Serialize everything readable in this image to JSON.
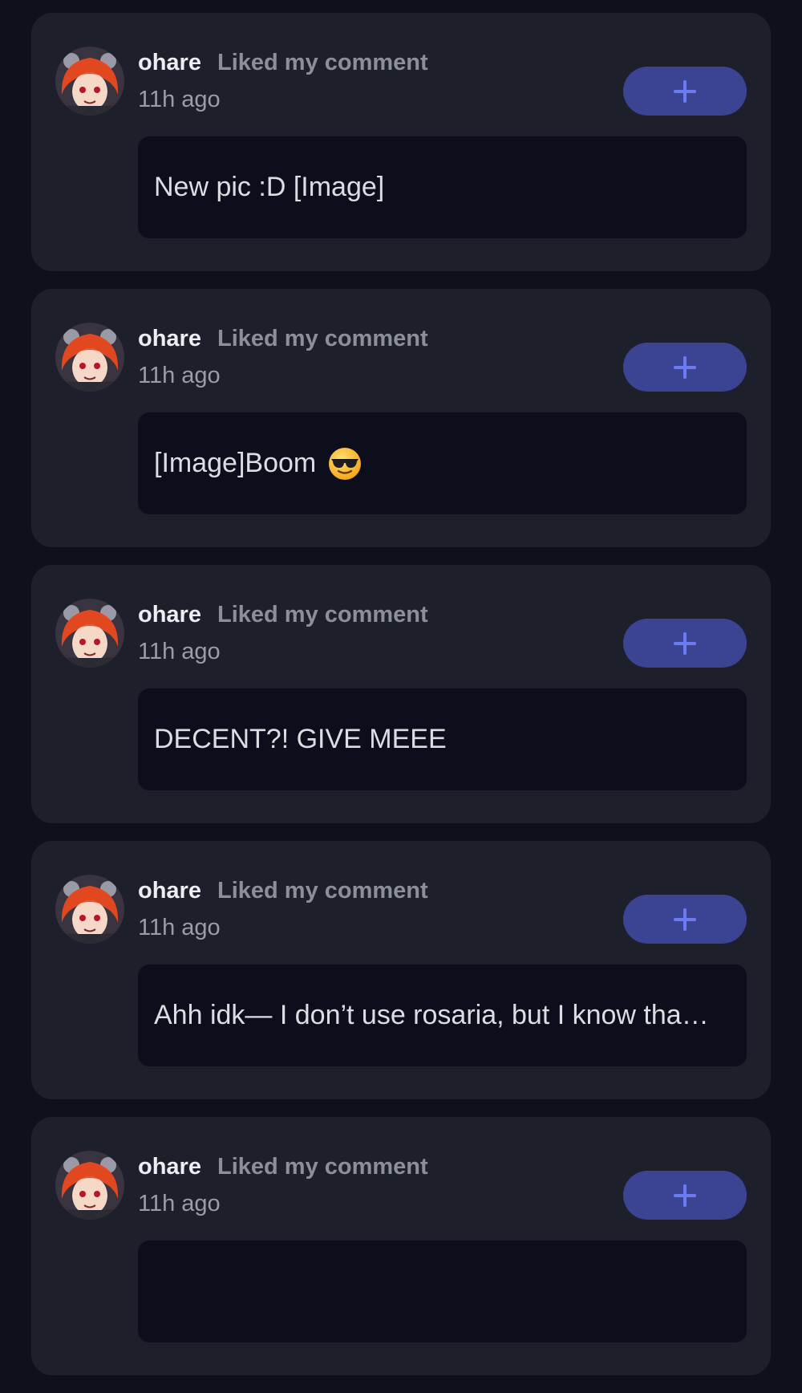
{
  "accent_color": "#3b4393",
  "plus_icon_color": "#6b7cf2",
  "notifications": [
    {
      "username": "ohare",
      "action": "Liked my comment",
      "time": "11h ago",
      "comment": "New pic :D [Image]",
      "emoji": null,
      "button_icon": "plus-icon"
    },
    {
      "username": "ohare",
      "action": "Liked my comment",
      "time": "11h ago",
      "comment": "[Image]Boom",
      "emoji": "sunglasses-emoji",
      "button_icon": "plus-icon"
    },
    {
      "username": "ohare",
      "action": "Liked my comment",
      "time": "11h ago",
      "comment": "DECENT?! GIVE MEEE",
      "emoji": null,
      "button_icon": "plus-icon"
    },
    {
      "username": "ohare",
      "action": "Liked my comment",
      "time": "11h ago",
      "comment": "Ahh idk— I don’t use rosaria, but I know tha…",
      "emoji": null,
      "button_icon": "plus-icon"
    },
    {
      "username": "ohare",
      "action": "Liked my comment",
      "time": "11h ago",
      "comment": "",
      "emoji": null,
      "button_icon": "plus-icon"
    }
  ]
}
